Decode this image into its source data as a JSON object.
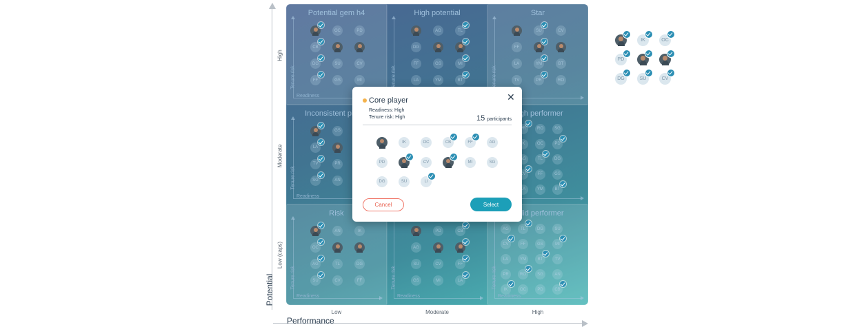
{
  "axes": {
    "y_title": "Potential",
    "x_title": "Performance",
    "y_ticks": [
      "High",
      "Moderate",
      "Low (caps)"
    ],
    "x_ticks": [
      "Low",
      "Moderate",
      "High"
    ]
  },
  "cell_axis": {
    "readiness": "Readiness",
    "tenure_risk": "Tenure risk"
  },
  "cells": [
    {
      "title": "Potential gem h4"
    },
    {
      "title": "High potential"
    },
    {
      "title": "Star"
    },
    {
      "title": "Inconsistent player"
    },
    {
      "title": ""
    },
    {
      "title": "High performer"
    },
    {
      "title": "Risk"
    },
    {
      "title": ""
    },
    {
      "title": "Solid performer"
    }
  ],
  "right_selection": [
    "photo",
    "IK",
    "OC",
    "PD",
    "photo",
    "photo",
    "DG",
    "SU",
    "CV"
  ],
  "modal": {
    "title": "Core player",
    "readiness": "Readiness: High",
    "tenure_risk": "Tenure risk: High",
    "count": "15",
    "count_label": "participants",
    "participants": [
      {
        "initials": "",
        "photo": true,
        "checked": false
      },
      {
        "initials": "IK",
        "photo": false,
        "checked": false
      },
      {
        "initials": "OC",
        "photo": false,
        "checked": false
      },
      {
        "initials": "CB",
        "photo": false,
        "checked": true
      },
      {
        "initials": "FF",
        "photo": false,
        "checked": true
      },
      {
        "initials": "AG",
        "photo": false,
        "checked": false
      },
      {
        "initials": "PD",
        "photo": false,
        "checked": false
      },
      {
        "initials": "",
        "photo": true,
        "checked": true
      },
      {
        "initials": "CV",
        "photo": false,
        "checked": false
      },
      {
        "initials": "",
        "photo": true,
        "checked": true
      },
      {
        "initials": "MI",
        "photo": false,
        "checked": false
      },
      {
        "initials": "SG",
        "photo": false,
        "checked": false
      },
      {
        "initials": "DG",
        "photo": false,
        "checked": false
      },
      {
        "initials": "SU",
        "photo": false,
        "checked": false
      },
      {
        "initials": "LI",
        "photo": false,
        "checked": true
      }
    ],
    "cancel_label": "Cancel",
    "select_label": "Select"
  },
  "colors": {
    "accent": "#1c9fb8",
    "cancel": "#e8604f",
    "dot": "#f4b24b",
    "check": "#2c8fb4"
  }
}
